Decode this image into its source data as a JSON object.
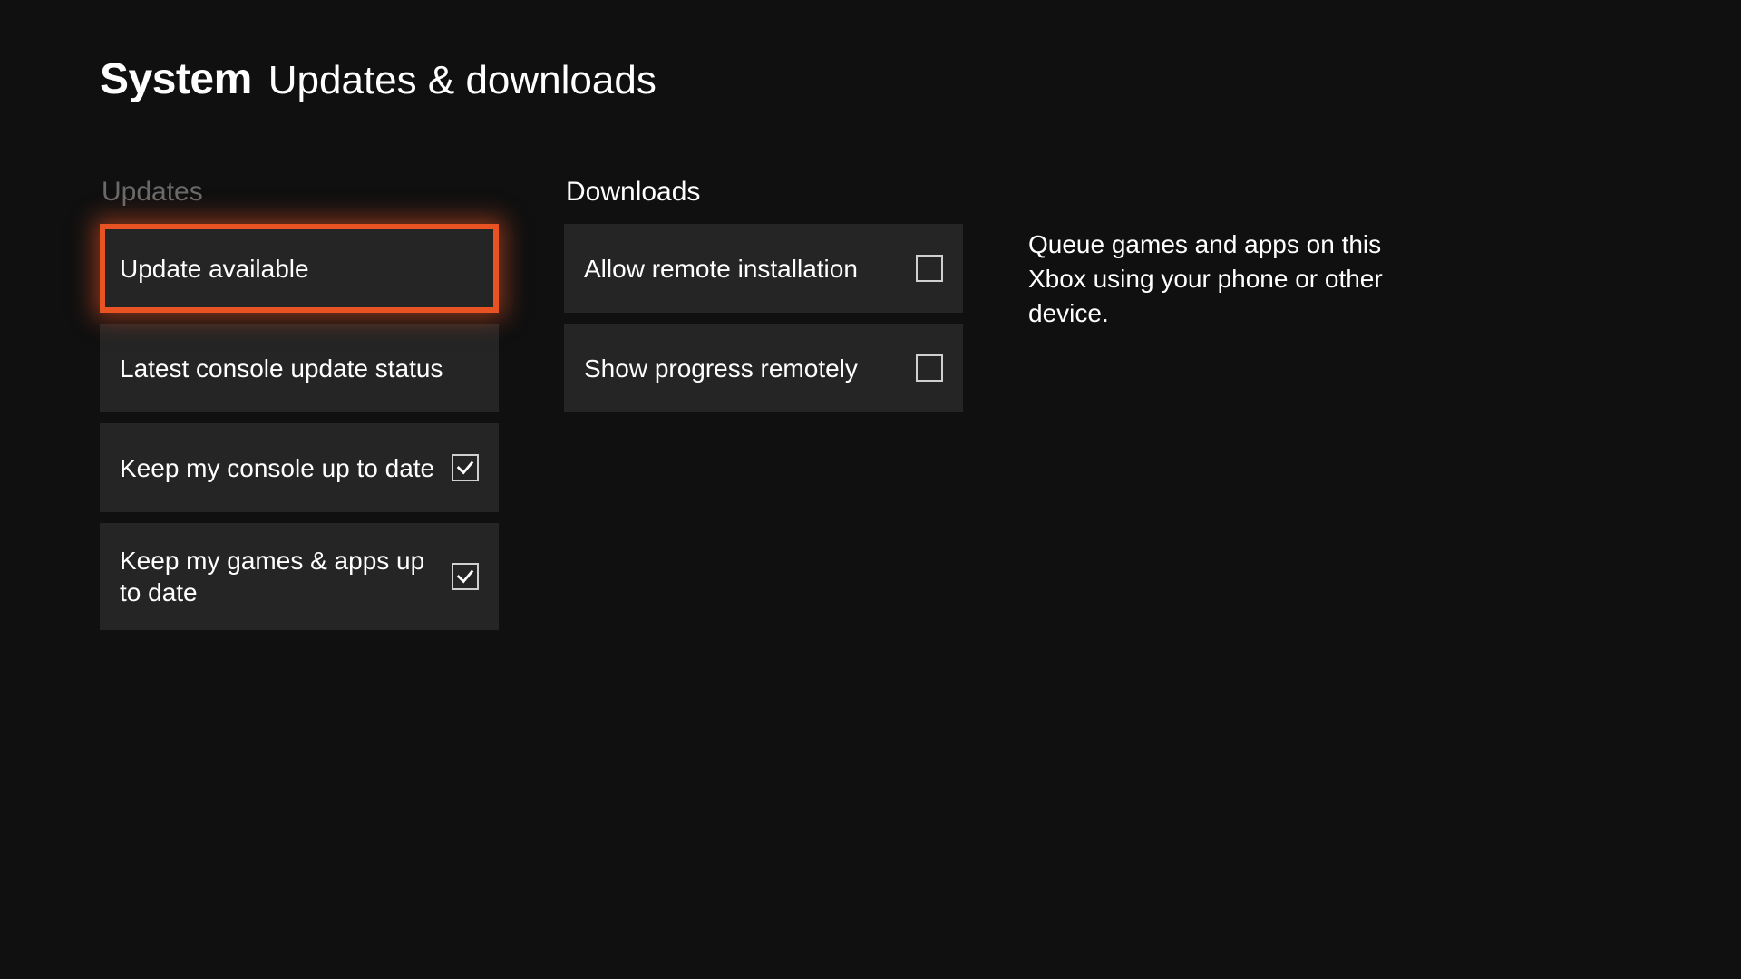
{
  "header": {
    "title": "System",
    "subtitle": "Updates & downloads"
  },
  "updates": {
    "section_title": "Updates",
    "items": [
      {
        "label": "Update available",
        "has_checkbox": false,
        "checked": false,
        "focused": true
      },
      {
        "label": "Latest console update status",
        "has_checkbox": false,
        "checked": false,
        "focused": false
      },
      {
        "label": "Keep my console up to date",
        "has_checkbox": true,
        "checked": true,
        "focused": false
      },
      {
        "label": "Keep my games & apps up to date",
        "has_checkbox": true,
        "checked": true,
        "focused": false
      }
    ]
  },
  "downloads": {
    "section_title": "Downloads",
    "items": [
      {
        "label": "Allow remote installation",
        "has_checkbox": true,
        "checked": false,
        "focused": false
      },
      {
        "label": "Show progress remotely",
        "has_checkbox": true,
        "checked": false,
        "focused": false
      }
    ]
  },
  "info": {
    "text": "Queue games and apps on this Xbox using your phone or other device."
  },
  "colors": {
    "focus": "#e85324",
    "tile_bg": "#252525",
    "page_bg": "#101010"
  }
}
